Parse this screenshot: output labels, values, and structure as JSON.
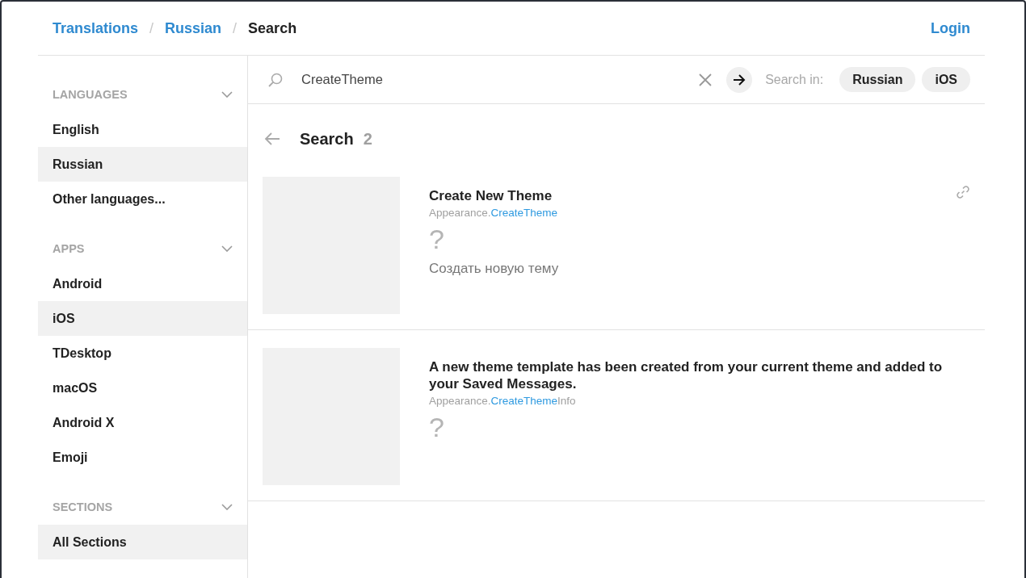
{
  "breadcrumbs": [
    {
      "kind": "link",
      "label": "Translations"
    },
    {
      "kind": "separator",
      "label": "/"
    },
    {
      "kind": "link",
      "label": "Russian"
    },
    {
      "kind": "separator",
      "label": "/"
    },
    {
      "kind": "current",
      "label": "Search"
    }
  ],
  "login": "Login",
  "sidebar": {
    "sections": [
      {
        "title": "LANGUAGES",
        "items": [
          {
            "label": "English",
            "selected": false
          },
          {
            "label": "Russian",
            "selected": true
          },
          {
            "label": "Other languages...",
            "selected": false
          }
        ]
      },
      {
        "title": "APPS",
        "items": [
          {
            "label": "Android",
            "selected": false
          },
          {
            "label": "iOS",
            "selected": true
          },
          {
            "label": "TDesktop",
            "selected": false
          },
          {
            "label": "macOS",
            "selected": false
          },
          {
            "label": "Android X",
            "selected": false
          },
          {
            "label": "Emoji",
            "selected": false
          }
        ]
      },
      {
        "title": "SECTIONS",
        "items": [
          {
            "label": "All Sections",
            "selected": true
          }
        ]
      }
    ]
  },
  "search": {
    "value": "CreateTheme",
    "search_in_label": "Search in:",
    "filters": [
      "Russian",
      "iOS"
    ]
  },
  "results_header": {
    "title": "Search",
    "count": "2"
  },
  "results": [
    {
      "title": "Create New Theme",
      "key_parts": [
        {
          "text": "Appearance.",
          "highlighted": false
        },
        {
          "text": "CreateTheme",
          "highlighted": true
        }
      ],
      "missing_mark": "?",
      "translation": "Создать новую тему",
      "link_icon": true
    },
    {
      "title": "A new theme template has been created from your current theme and added to your Saved Messages.",
      "key_parts": [
        {
          "text": "Appearance.",
          "highlighted": false
        },
        {
          "text": "CreateTheme",
          "highlighted": true
        },
        {
          "text": "Info",
          "highlighted": false
        }
      ],
      "missing_mark": "?",
      "link_icon": false
    }
  ]
}
